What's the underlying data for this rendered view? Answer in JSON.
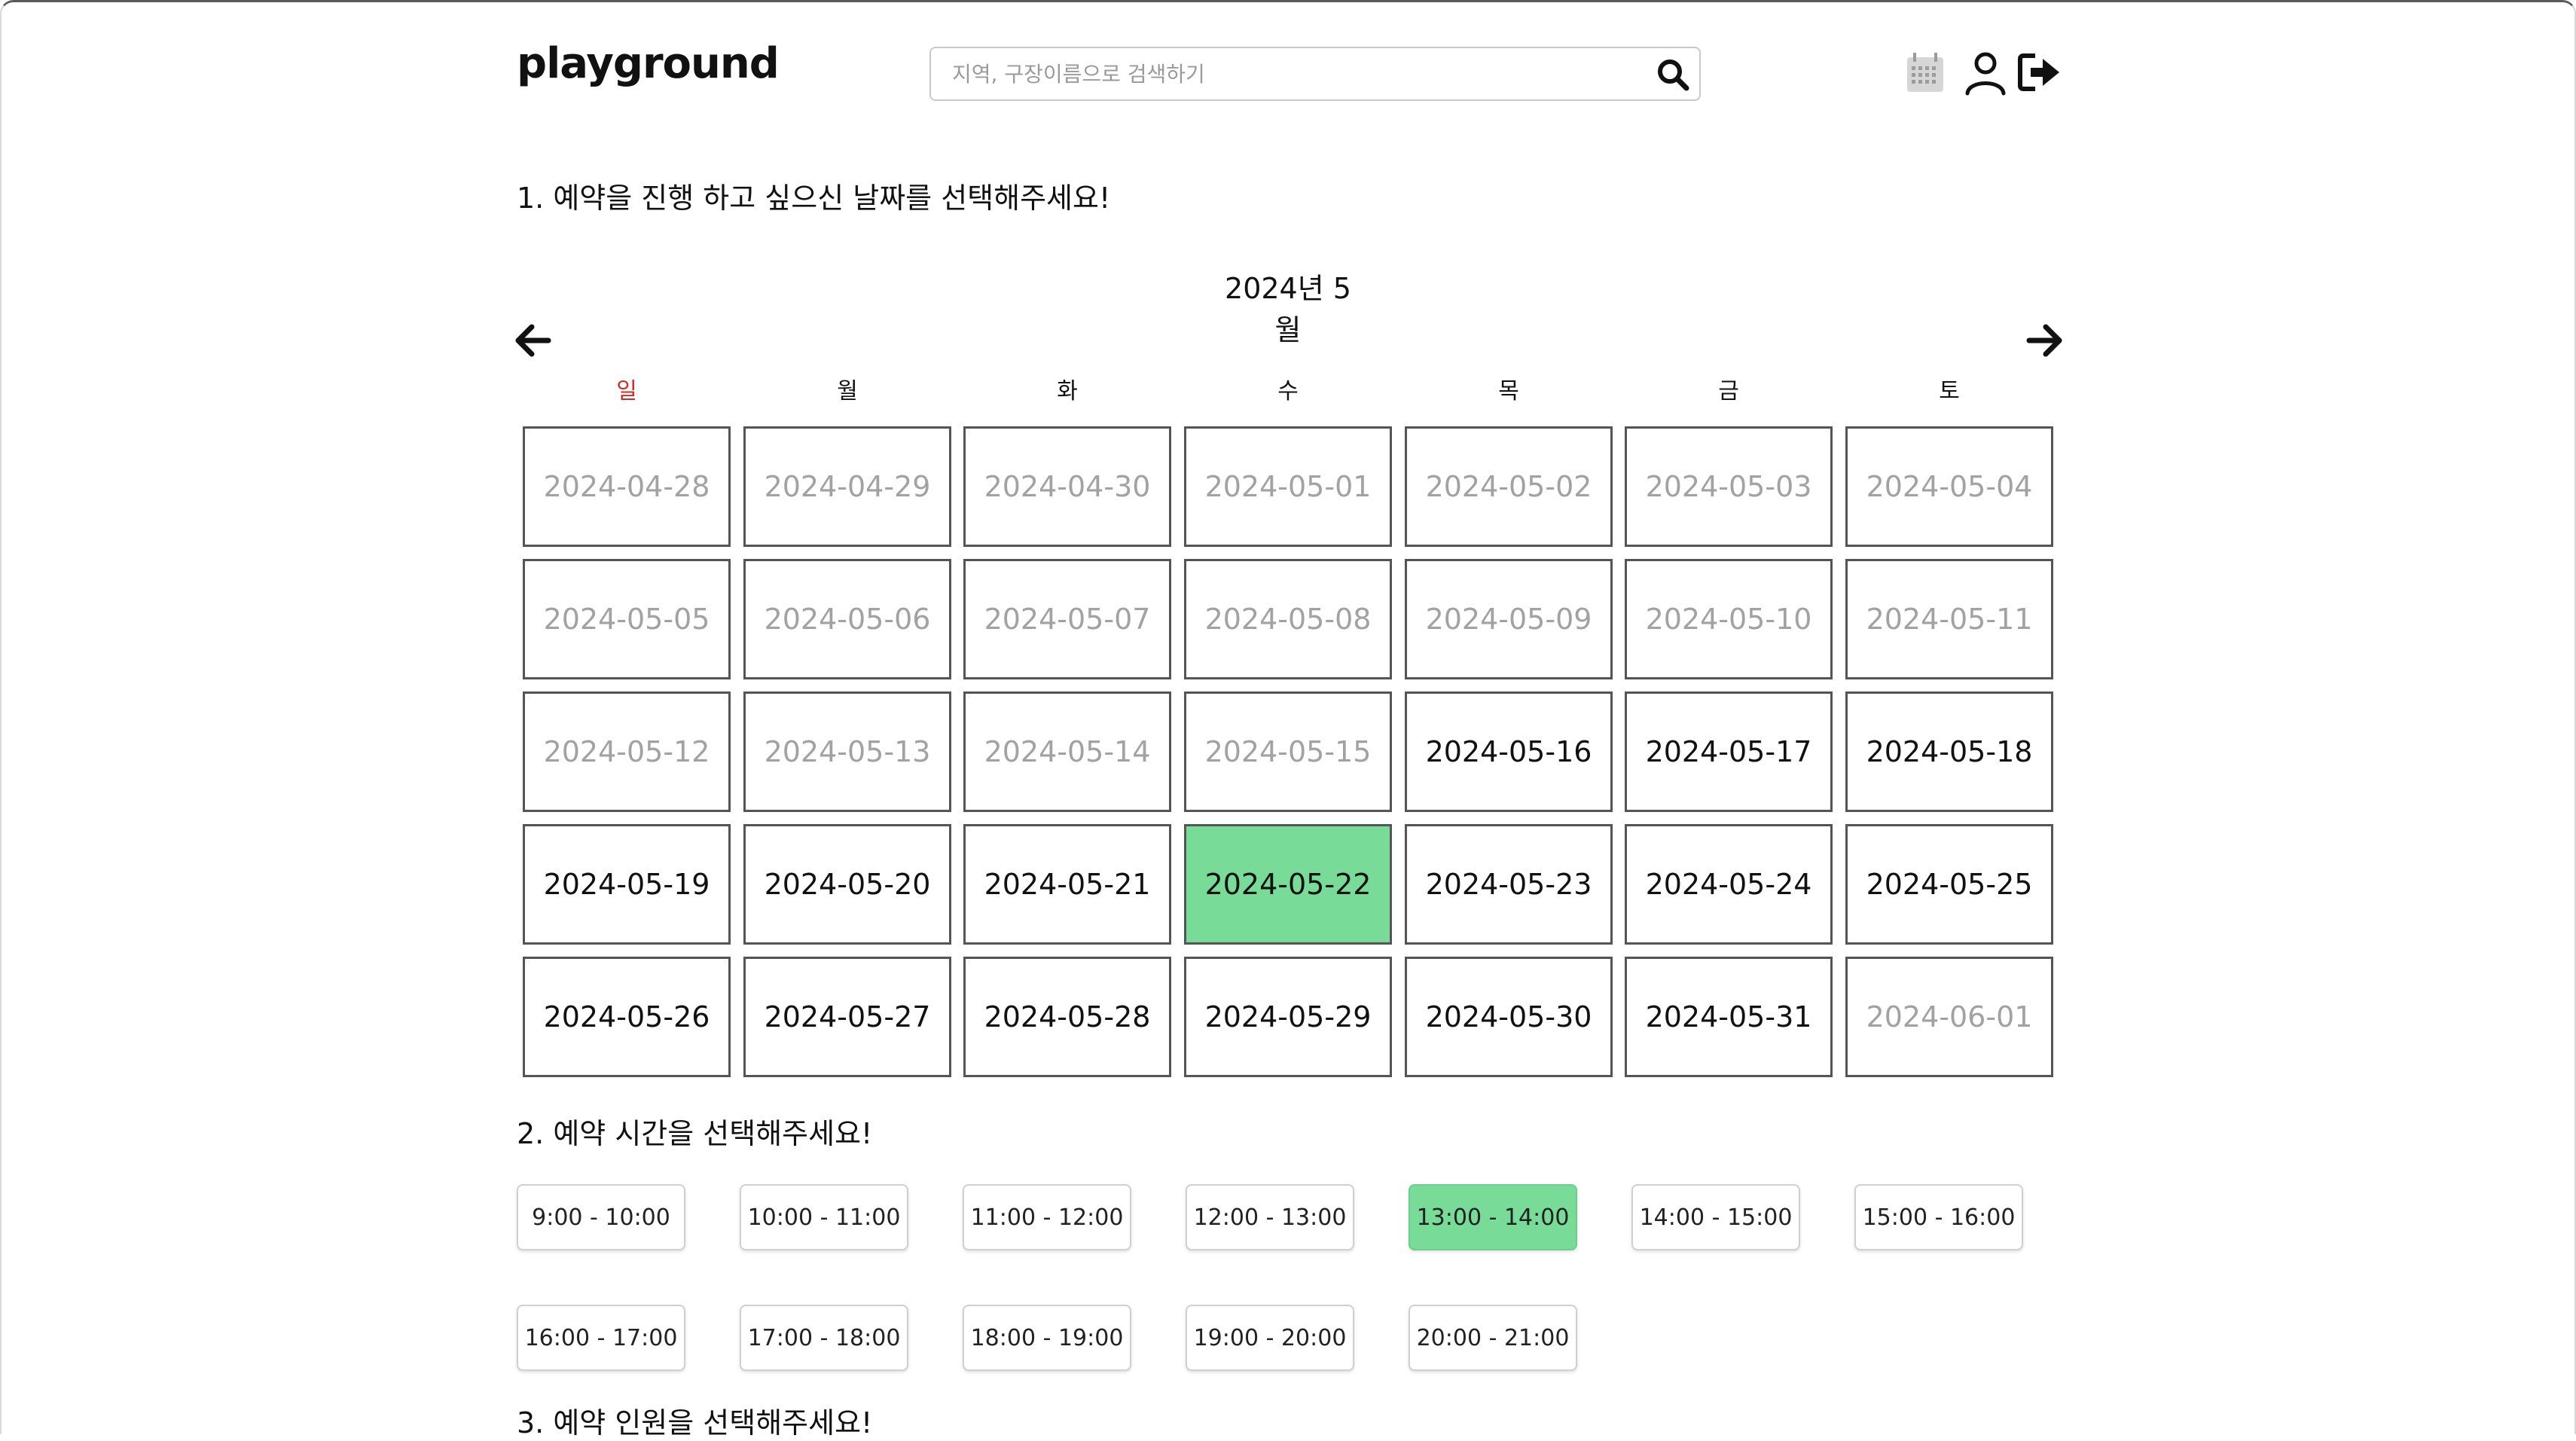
{
  "header": {
    "logo": "playground",
    "search_placeholder": "지역, 구장이름으로 검색하기",
    "icons": [
      "search-icon",
      "calendar-icon",
      "user-icon",
      "logout-icon"
    ]
  },
  "step1": {
    "title": "1. 예약을 진행 하고 싶으신 날짜를 선택해주세요!",
    "month_label": "2024년 5월",
    "weekdays": [
      "일",
      "월",
      "화",
      "수",
      "목",
      "금",
      "토"
    ],
    "weeks": [
      [
        "2024-04-28",
        "2024-04-29",
        "2024-04-30",
        "2024-05-01",
        "2024-05-02",
        "2024-05-03",
        "2024-05-04"
      ],
      [
        "2024-05-05",
        "2024-05-06",
        "2024-05-07",
        "2024-05-08",
        "2024-05-09",
        "2024-05-10",
        "2024-05-11"
      ],
      [
        "2024-05-12",
        "2024-05-13",
        "2024-05-14",
        "2024-05-15",
        "2024-05-16",
        "2024-05-17",
        "2024-05-18"
      ],
      [
        "2024-05-19",
        "2024-05-20",
        "2024-05-21",
        "2024-05-22",
        "2024-05-23",
        "2024-05-24",
        "2024-05-25"
      ],
      [
        "2024-05-26",
        "2024-05-27",
        "2024-05-28",
        "2024-05-29",
        "2024-05-30",
        "2024-05-31",
        "2024-06-01"
      ]
    ],
    "disabled_dates": [
      "2024-04-28",
      "2024-04-29",
      "2024-04-30",
      "2024-05-01",
      "2024-05-02",
      "2024-05-03",
      "2024-05-04",
      "2024-05-05",
      "2024-05-06",
      "2024-05-07",
      "2024-05-08",
      "2024-05-09",
      "2024-05-10",
      "2024-05-11",
      "2024-05-12",
      "2024-05-13",
      "2024-05-14",
      "2024-05-15",
      "2024-06-01"
    ],
    "selected_date": "2024-05-22"
  },
  "step2": {
    "title": "2. 예약 시간을 선택해주세요!",
    "slots": [
      "9:00 - 10:00",
      "10:00 - 11:00",
      "11:00 - 12:00",
      "12:00 - 13:00",
      "13:00 - 14:00",
      "14:00 - 15:00",
      "15:00 - 16:00",
      "16:00 - 17:00",
      "17:00 - 18:00",
      "18:00 - 19:00",
      "19:00 - 20:00",
      "20:00 - 21:00"
    ],
    "selected_slot": "13:00 - 14:00"
  },
  "step3": {
    "title": "3. 예약 인원을 선택해주세요!"
  },
  "colors": {
    "selected": "#78dc98",
    "sunday": "#d42a2a",
    "disabled_text": "#a2a2a2",
    "cell_border": "#555555"
  }
}
